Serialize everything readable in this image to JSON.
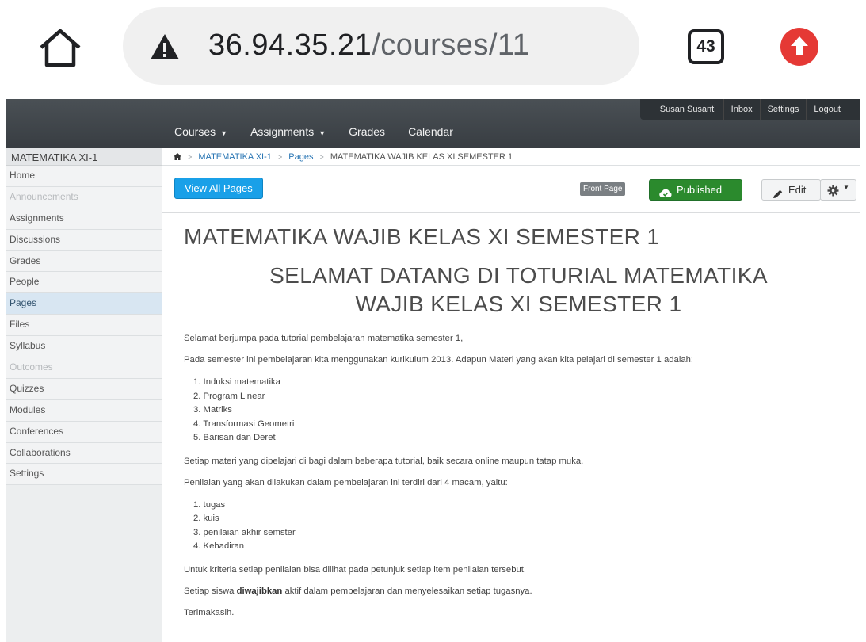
{
  "browser": {
    "url_host": "36.94.35.21",
    "url_path": "/courses/11",
    "tab_count": "43",
    "icons": [
      "home-icon",
      "warning-icon",
      "tabs-icon",
      "update-icon"
    ]
  },
  "header": {
    "user_nav": [
      "Susan Susanti",
      "Inbox",
      "Settings",
      "Logout"
    ],
    "menu": [
      {
        "label": "Courses",
        "has_caret": true
      },
      {
        "label": "Assignments",
        "has_caret": true
      },
      {
        "label": "Grades",
        "has_caret": false
      },
      {
        "label": "Calendar",
        "has_caret": false
      }
    ]
  },
  "sidebar": {
    "course_name": "MATEMATIKA XI-1",
    "items": [
      {
        "label": "Home",
        "state": "normal"
      },
      {
        "label": "Announcements",
        "state": "disabled"
      },
      {
        "label": "Assignments",
        "state": "normal"
      },
      {
        "label": "Discussions",
        "state": "normal"
      },
      {
        "label": "Grades",
        "state": "normal"
      },
      {
        "label": "People",
        "state": "normal"
      },
      {
        "label": "Pages",
        "state": "active"
      },
      {
        "label": "Files",
        "state": "normal"
      },
      {
        "label": "Syllabus",
        "state": "normal"
      },
      {
        "label": "Outcomes",
        "state": "disabled"
      },
      {
        "label": "Quizzes",
        "state": "normal"
      },
      {
        "label": "Modules",
        "state": "normal"
      },
      {
        "label": "Conferences",
        "state": "normal"
      },
      {
        "label": "Collaborations",
        "state": "normal"
      },
      {
        "label": "Settings",
        "state": "normal"
      }
    ]
  },
  "breadcrumb": {
    "course": "MATEMATIKA XI-1",
    "section": "Pages",
    "current": "MATEMATIKA WAJIB KELAS XI SEMESTER 1"
  },
  "toolbar": {
    "view_all_label": "View All Pages",
    "front_page_badge": "Front Page",
    "published_label": "Published",
    "edit_label": "Edit",
    "colors": {
      "view_all": "#19a0e8",
      "published": "#2b8a2d"
    }
  },
  "page": {
    "title": "MATEMATIKA WAJIB KELAS XI SEMESTER 1",
    "heading_line1": "SELAMAT DATANG DI TOTURIAL MATEMATIKA",
    "heading_line2": "WAJIB KELAS XI SEMESTER 1",
    "intro": "Selamat berjumpa pada tutorial pembelajaran matematika semester 1,",
    "materi_intro": "Pada semester ini pembelajaran kita menggunakan kurikulum 2013. Adapun Materi yang akan kita pelajari di semester 1 adalah:",
    "materi": [
      "1. Induksi matematika",
      "2. Program Linear",
      "3. Matriks",
      "4. Transformasi Geometri",
      "5. Barisan dan Deret"
    ],
    "tutorial_note": "Setiap materi yang dipelajari di bagi dalam beberapa tutorial, baik secara online maupun tatap muka.",
    "penilaian_intro": "Penilaian yang akan dilakukan dalam pembelajaran ini terdiri dari 4 macam, yaitu:",
    "penilaian": [
      "1. tugas",
      "2. kuis",
      "3. penilaian akhir semster",
      "4. Kehadiran"
    ],
    "kriteria": "Untuk kriteria setiap penilaian bisa dilihat pada petunjuk setiap item penilaian tersebut.",
    "wajib_pre": "Setiap siswa ",
    "wajib_bold": "diwajibkan",
    "wajib_post": " aktif dalam pembelajaran dan menyelesaikan setiap tugasnya.",
    "closing": "Terimakasih."
  }
}
